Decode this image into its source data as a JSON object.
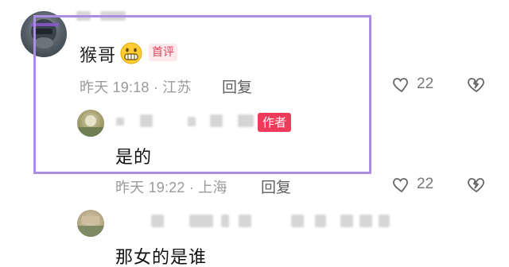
{
  "comment_first": {
    "user_name": "猴哥",
    "badge": "首评",
    "time_location": "昨天 19:18 · 江苏",
    "reply_label": "回复",
    "like_count": "22"
  },
  "comment_reply": {
    "badge": "作者",
    "text": "是的",
    "time_location": "昨天 19:22 · 上海",
    "reply_label": "回复",
    "like_count": "22"
  },
  "comment_third": {
    "text": "那女的是谁"
  }
}
